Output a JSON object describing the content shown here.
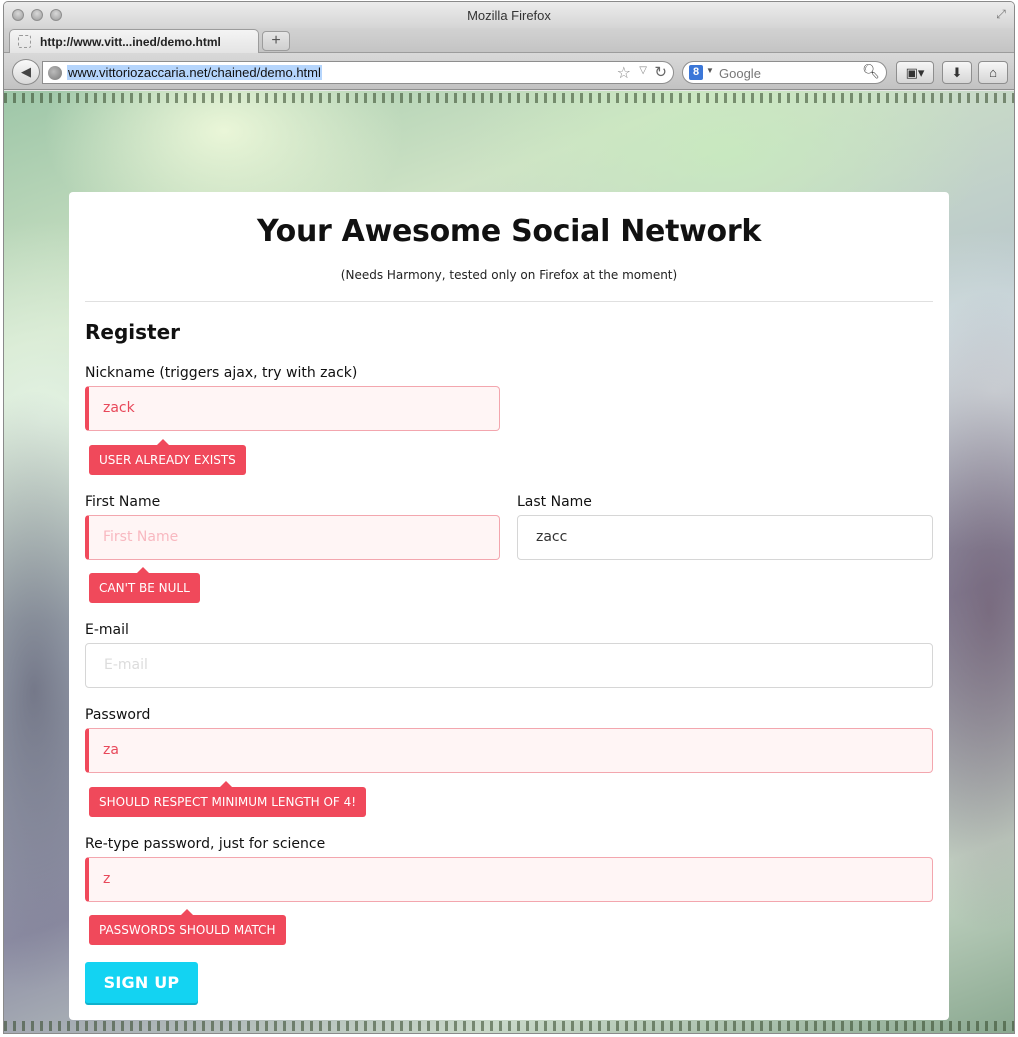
{
  "browser": {
    "window_title": "Mozilla Firefox",
    "tab_label": "http://www.vitt...ined/demo.html",
    "new_tab": "+",
    "back": "◀",
    "url": "www.vittoriozaccaria.net/chained/demo.html",
    "search_engine_icon": "8",
    "search_placeholder": "Google"
  },
  "page": {
    "title": "Your Awesome Social Network",
    "subtitle": "(Needs Harmony, tested only on Firefox at the moment)",
    "section_title": "Register"
  },
  "form": {
    "nickname": {
      "label": "Nickname (triggers ajax, try with zack)",
      "value": "zack",
      "error": "USER ALREADY EXISTS"
    },
    "first_name": {
      "label": "First Name",
      "placeholder": "First Name",
      "error": "CAN'T BE NULL"
    },
    "last_name": {
      "label": "Last Name",
      "value": "zacc"
    },
    "email": {
      "label": "E-mail",
      "placeholder": "E-mail"
    },
    "password": {
      "label": "Password",
      "value": "za",
      "error": "SHOULD RESPECT MINIMUM LENGTH OF 4!"
    },
    "retype": {
      "label": "Re-type password, just for science",
      "value": "z",
      "error": "PASSWORDS SHOULD MATCH"
    },
    "submit_label": "SIGN UP"
  },
  "colors": {
    "error": "#f0495b",
    "accent": "#13d3f2",
    "error_bg": "#fff5f5"
  }
}
